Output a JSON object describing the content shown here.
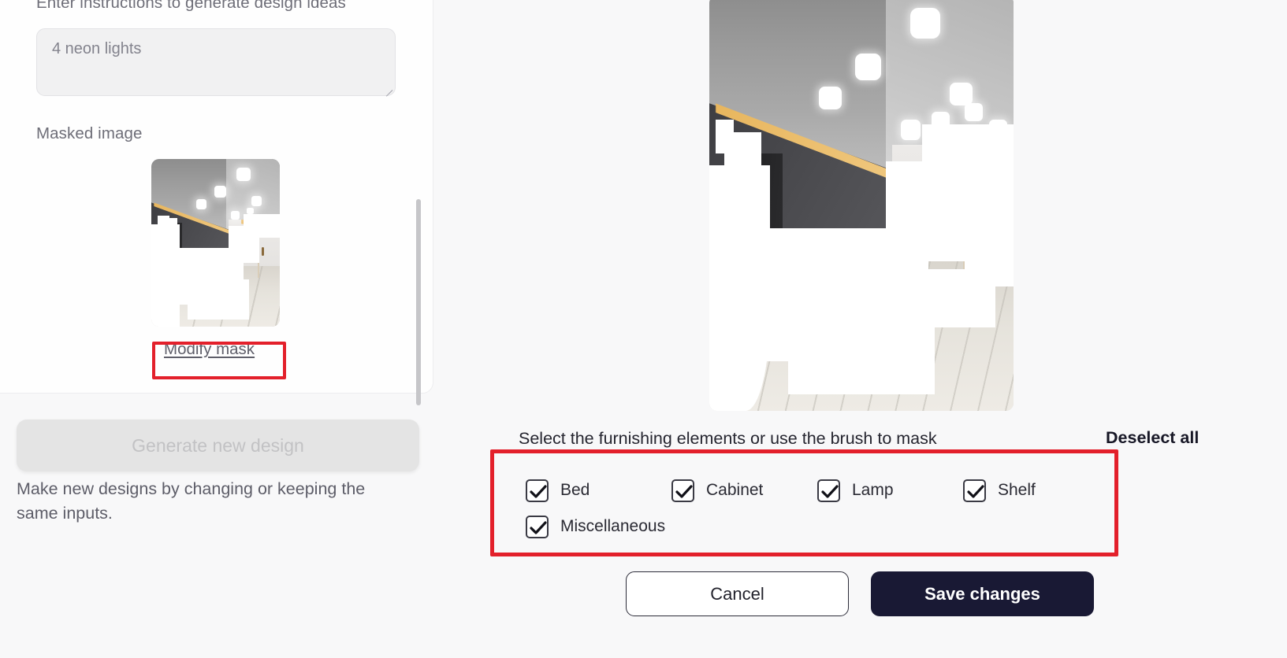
{
  "left_panel": {
    "instructions_label": "Enter instructions to generate design ideas",
    "prompt": {
      "value": "4 neon lights",
      "placeholder": "4 neon lights"
    },
    "masked_image_label": "Masked image",
    "modify_mask_link": "Modify mask",
    "generate_button": "Generate new design",
    "helper_text": "Make new designs by changing or keeping the same inputs."
  },
  "right_panel": {
    "select_label": "Select the furnishing elements or use the brush to mask",
    "deselect_all": "Deselect all",
    "checkboxes": [
      {
        "label": "Bed",
        "checked": true
      },
      {
        "label": "Cabinet",
        "checked": true
      },
      {
        "label": "Lamp",
        "checked": true
      },
      {
        "label": "Shelf",
        "checked": true
      },
      {
        "label": "Miscellaneous",
        "checked": true
      }
    ],
    "cancel_button": "Cancel",
    "save_button": "Save changes"
  },
  "icons": {
    "checkmark": "check-icon",
    "resize_grip": "resize-grip-icon"
  },
  "colors": {
    "accent_highlight": "#e3202b",
    "primary_button": "#191934",
    "page_background": "#f8f8f9",
    "disabled_button": "#e4e4e4"
  }
}
